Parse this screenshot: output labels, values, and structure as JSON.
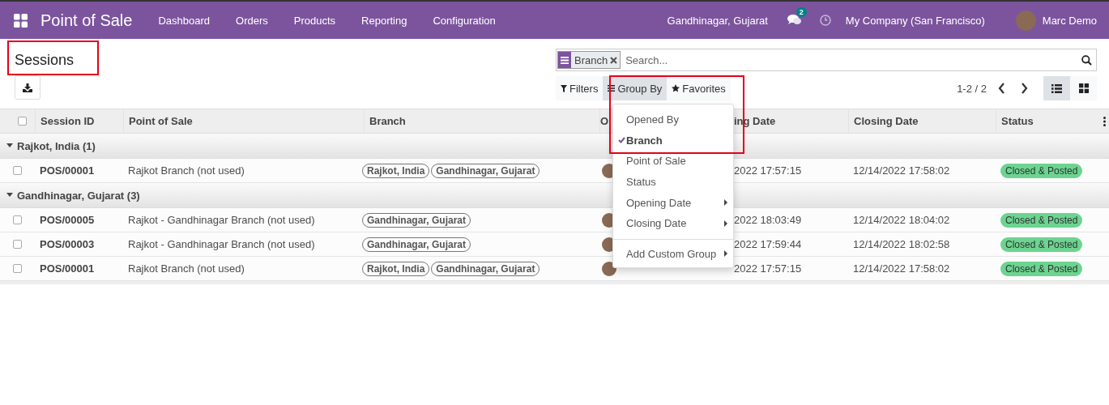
{
  "navbar": {
    "app_name": "Point of Sale",
    "menu": [
      "Dashboard",
      "Orders",
      "Products",
      "Reporting",
      "Configuration"
    ],
    "branch": "Gandhinagar, Gujarat",
    "messages_badge": "2",
    "company": "My Company (San Francisco)",
    "user": "Marc Demo"
  },
  "control_panel": {
    "title": "Sessions",
    "search": {
      "facet": "Branch",
      "placeholder": "Search..."
    },
    "search_buttons": [
      {
        "label": "Filters",
        "kind": "filter",
        "selected": false
      },
      {
        "label": "Group By",
        "kind": "group",
        "selected": true
      },
      {
        "label": "Favorites",
        "kind": "star",
        "selected": false
      }
    ],
    "pager": "1-2 / 2",
    "views": [
      {
        "kind": "list",
        "selected": true
      },
      {
        "kind": "kanban",
        "selected": false
      }
    ]
  },
  "group_by_menu": {
    "items": [
      {
        "label": "Opened By",
        "checked": false,
        "submenu": false
      },
      {
        "label": "Branch",
        "checked": true,
        "submenu": false
      },
      {
        "label": "Point of Sale",
        "checked": false,
        "submenu": false
      },
      {
        "label": "Status",
        "checked": false,
        "submenu": false
      },
      {
        "label": "Opening Date",
        "checked": false,
        "submenu": true
      },
      {
        "label": "Closing Date",
        "checked": false,
        "submenu": true
      }
    ],
    "custom_group": {
      "label": "Add Custom Group",
      "submenu": true
    }
  },
  "table": {
    "all_checked": false,
    "columns": [
      "Session ID",
      "Point of Sale",
      "Branch",
      "O",
      "ing Date",
      "Closing Date",
      "Status"
    ],
    "groups": [
      {
        "label": "Rajkot, India (1)",
        "expanded": true,
        "rows": [
          {
            "checked": false,
            "session_id": "POS/00001",
            "point_of_sale": "Rajkot Branch (not used)",
            "branches": [
              "Rajkot, India",
              "Gandhinagar, Gujarat"
            ],
            "opening_date": "2022 17:57:15",
            "closing_date": "12/14/2022 17:58:02",
            "status": "Closed & Posted"
          }
        ]
      },
      {
        "label": "Gandhinagar, Gujarat (3)",
        "expanded": true,
        "rows": [
          {
            "checked": false,
            "session_id": "POS/00005",
            "point_of_sale": "Rajkot - Gandhinagar Branch (not used)",
            "branches": [
              "Gandhinagar, Gujarat"
            ],
            "opening_date": "2022 18:03:49",
            "closing_date": "12/14/2022 18:04:02",
            "status": "Closed & Posted"
          },
          {
            "checked": false,
            "session_id": "POS/00003",
            "point_of_sale": "Rajkot - Gandhinagar Branch (not used)",
            "branches": [
              "Gandhinagar, Gujarat"
            ],
            "opening_date": "2022 17:59:44",
            "closing_date": "12/14/2022 18:02:58",
            "status": "Closed & Posted"
          },
          {
            "checked": false,
            "session_id": "POS/00001",
            "point_of_sale": "Rajkot Branch (not used)",
            "branches": [
              "Rajkot, India",
              "Gandhinagar, Gujarat"
            ],
            "opening_date": "2022 17:57:15",
            "closing_date": "12/14/2022 17:58:02",
            "status": "Closed & Posted"
          }
        ]
      }
    ]
  }
}
